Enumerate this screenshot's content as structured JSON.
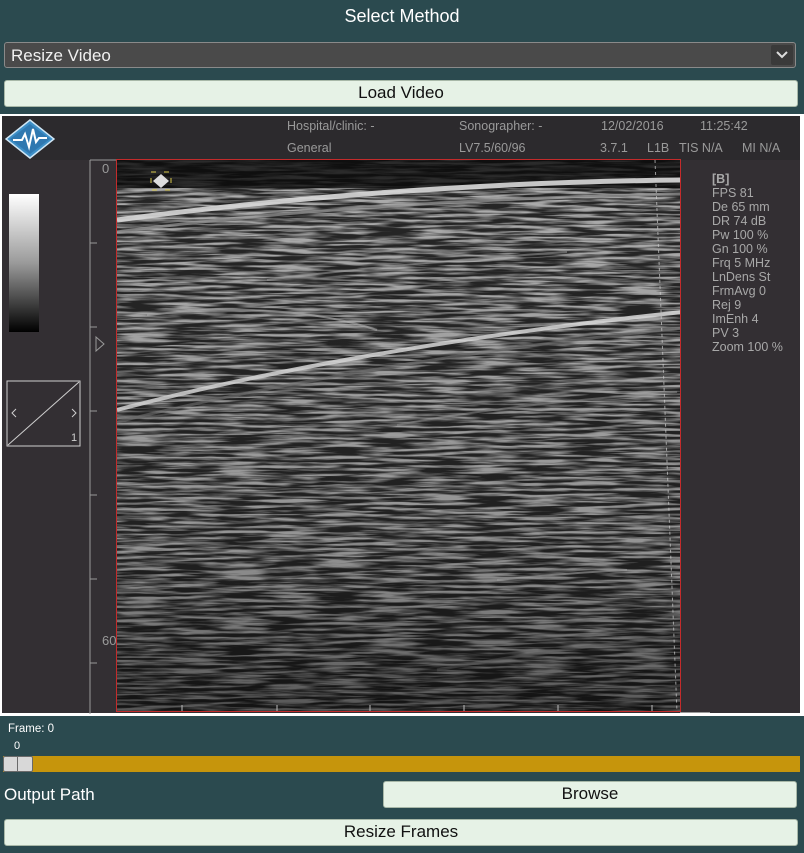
{
  "title": "Select Method",
  "method_select": {
    "value": "Resize Video"
  },
  "load_button": "Load Video",
  "ultrasound": {
    "header": {
      "hospital": "Hospital/clinic: -",
      "sonographer": "Sonographer: -",
      "date": "12/02/2016",
      "time": "11:25:42",
      "preset": "General",
      "probe": "LV7.5/60/96",
      "version": "3.7.1",
      "mode_l1b": "L1B",
      "tis": "TIS N/A",
      "mi": "MI N/A"
    },
    "depth_labels": [
      "0",
      "60"
    ],
    "info": [
      "[B]",
      "FPS 81",
      "De 65 mm",
      "DR 74 dB",
      "Pw 100 %",
      "Gn 100 %",
      "Frq 5 MHz",
      "LnDens St",
      "FrmAvg 0",
      "Rej 9",
      "ImEnh 4",
      "PV 3",
      "Zoom 100 %"
    ],
    "gain_box_label": "1"
  },
  "frame": {
    "label": "Frame: 0",
    "value": "0",
    "progress": 0
  },
  "output": {
    "label": "Output Path",
    "browse": "Browse"
  },
  "resize_button": "Resize Frames",
  "colors": {
    "background": "#2b4a4f",
    "button": "#e6f2e6",
    "slider": "#c6950c",
    "scan_border": "#c42b2b"
  }
}
